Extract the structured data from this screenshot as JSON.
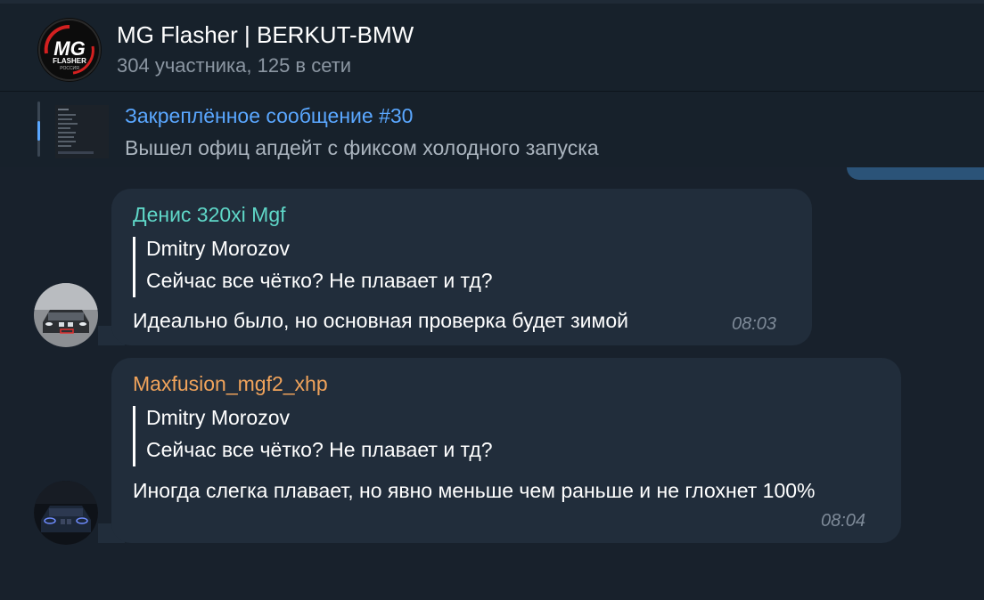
{
  "chat": {
    "title": "MG Flasher | BERKUT-BMW",
    "subtitle": "304 участника, 125 в сети",
    "logo": {
      "icon": "mg-flasher-logo",
      "text_main": "MG",
      "text_sub": "FLASHER",
      "text_small": "РОССИЯ"
    }
  },
  "pinned": {
    "title": "Закреплённое сообщение #30",
    "text": "Вышел офиц апдейт с фиксом холодного запуска"
  },
  "messages": [
    {
      "sender": "Денис 320xi Mgf",
      "sender_color": "#5fd7c8",
      "reply_author": "Dmitry Morozov",
      "reply_text": "Сейчас все чётко? Не плавает и тд?",
      "text": "Идеально было, но основная проверка будет зимой",
      "time": "08:03",
      "avatar_icon": "white-bmw-car-icon"
    },
    {
      "sender": "Maxfusion_mgf2_xhp",
      "sender_color": "#f0a35b",
      "reply_author": "Dmitry Morozov",
      "reply_text": "Сейчас все чётко? Не плавает и тд?",
      "text": "Иногда слегка плавает, но явно меньше чем раньше и не глохнет 100%",
      "time": "08:04",
      "avatar_icon": "dark-bmw-car-icon"
    }
  ],
  "colors": {
    "background": "#18212c",
    "bubble": "#212d3b",
    "accent": "#5aa7ff"
  }
}
